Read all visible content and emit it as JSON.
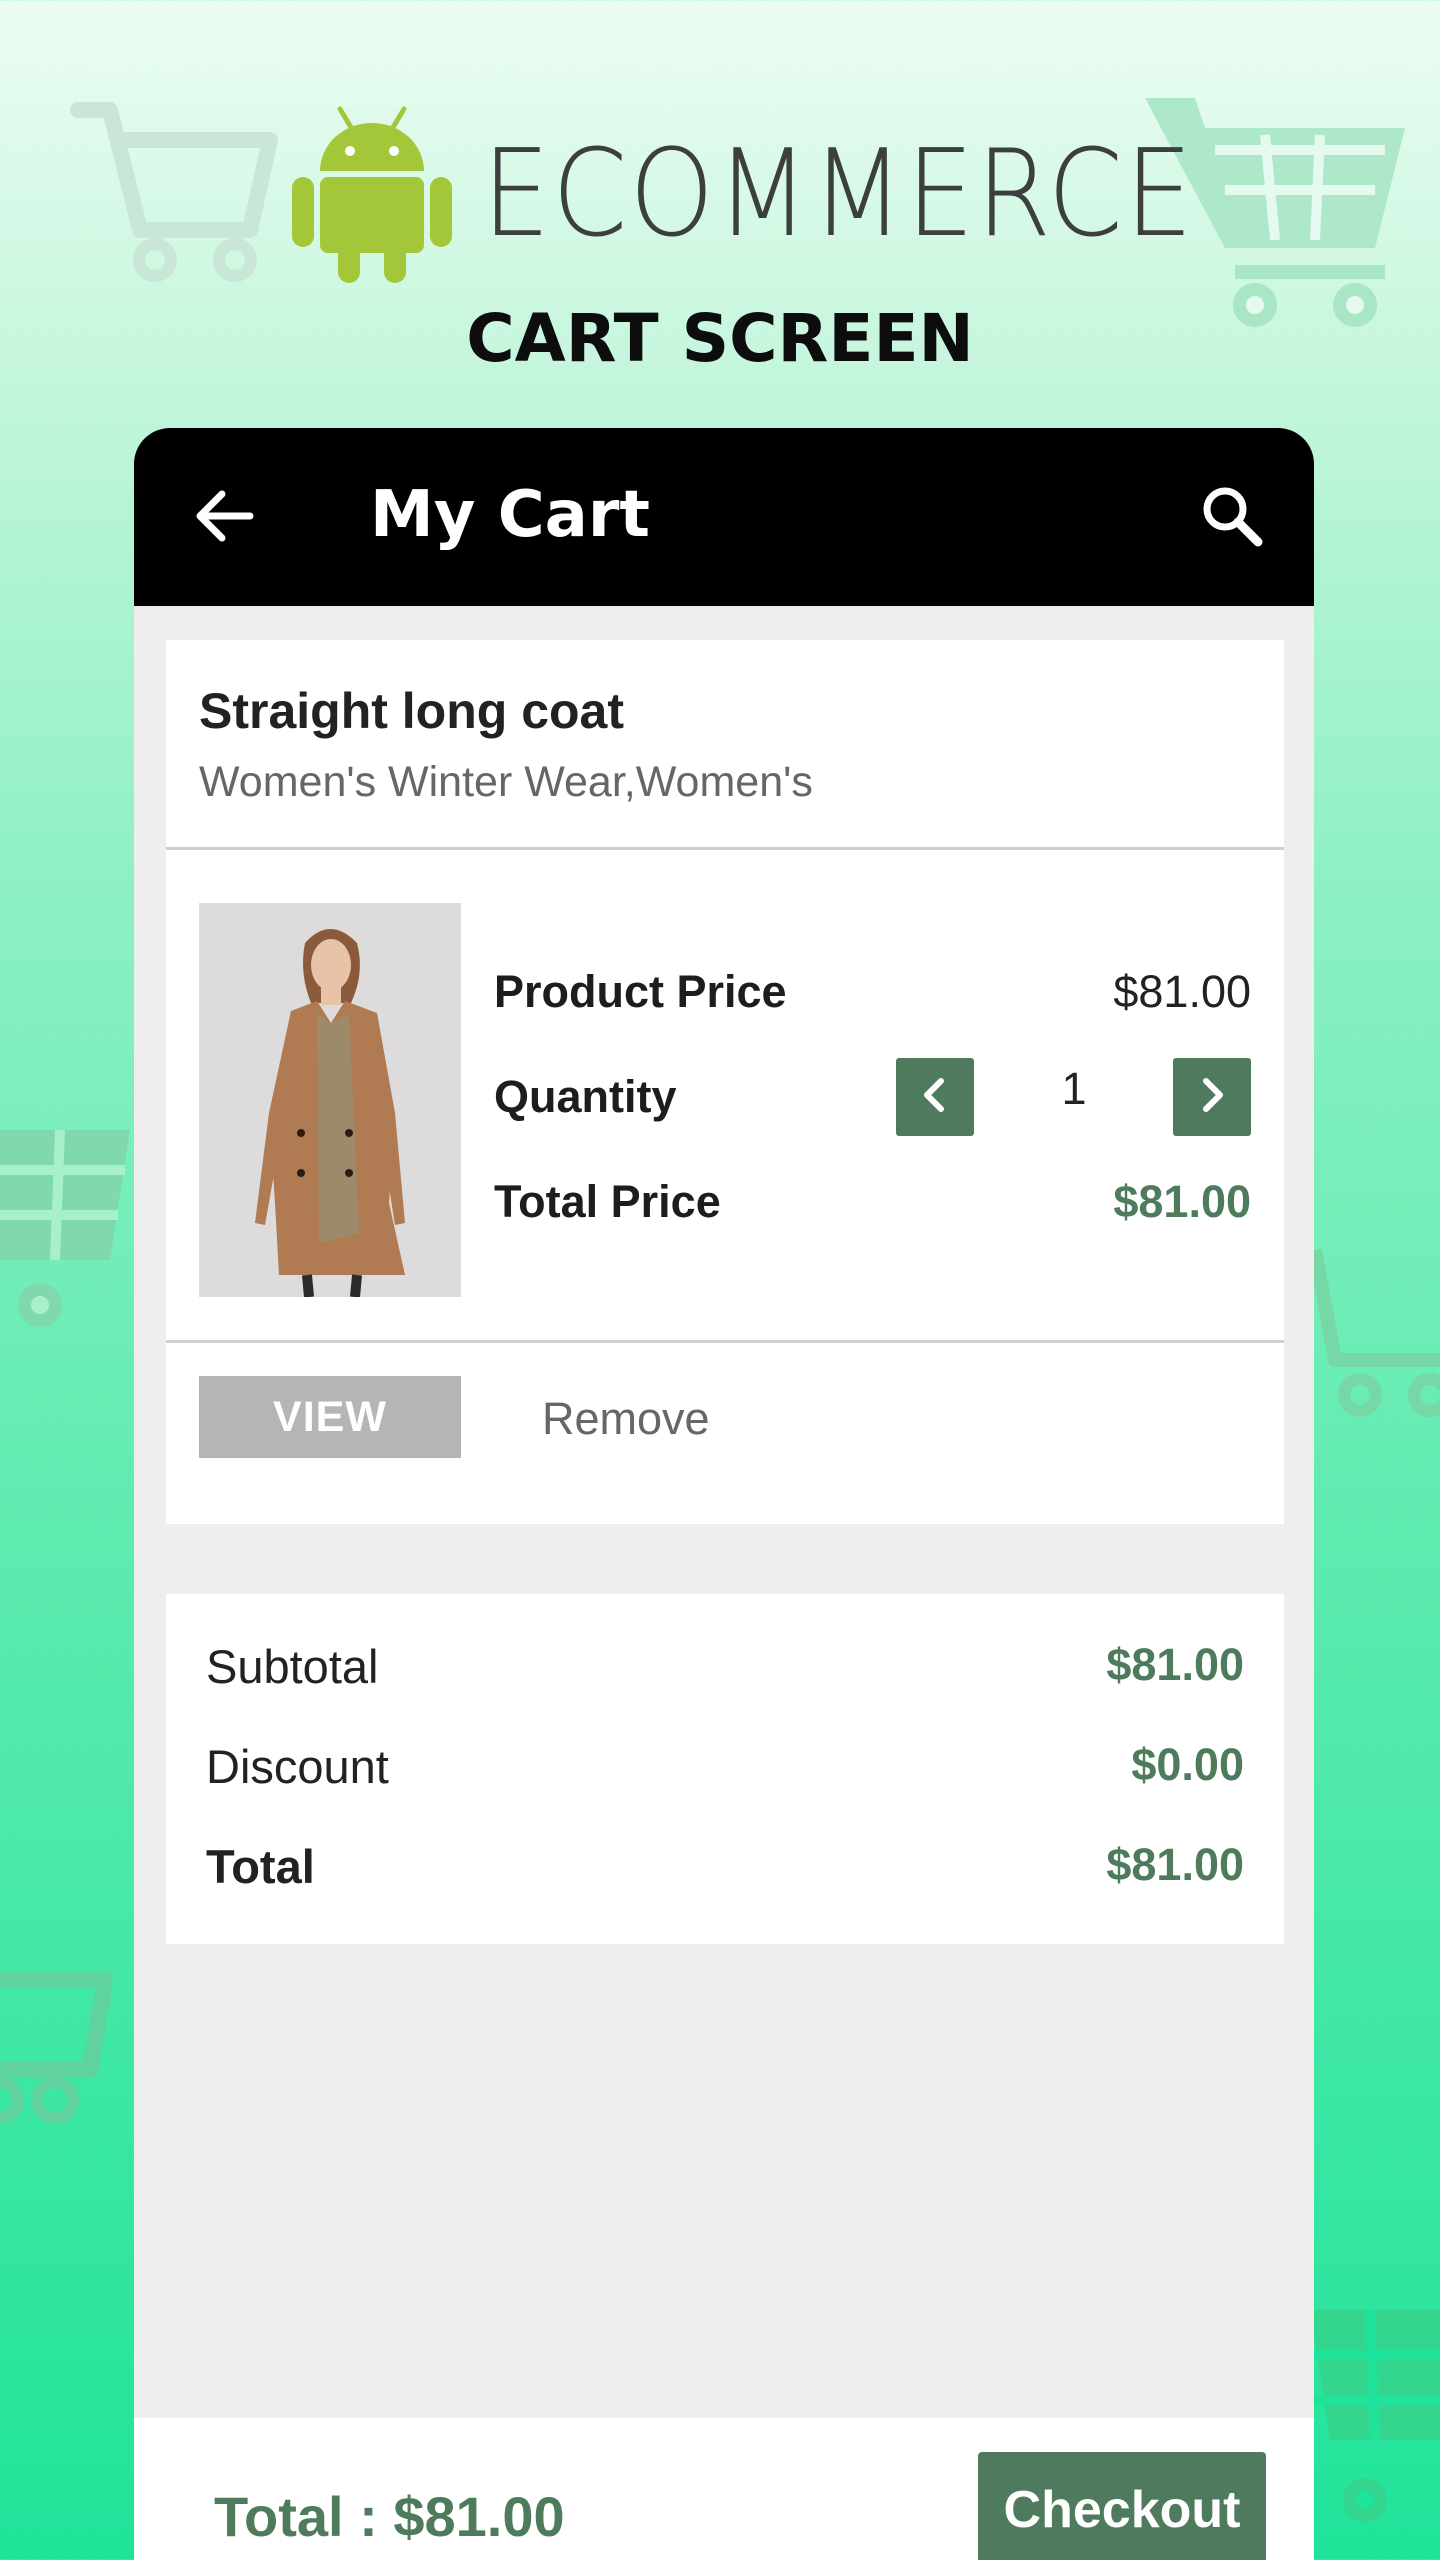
{
  "brand": {
    "wordmark": "ECOMMERCE",
    "screen_title": "CART SCREEN",
    "logo_icon": "android-icon",
    "colors": {
      "android_green": "#a4c639",
      "cart_watermark": "#7fd9ad"
    }
  },
  "appbar": {
    "title": "My Cart",
    "back_icon": "arrow-left-icon",
    "search_icon": "search-icon"
  },
  "cart_item": {
    "name": "Straight long coat",
    "category": "Women's Winter Wear,Women's",
    "image_description": "woman-in-camel-coat",
    "product_price_label": "Product Price",
    "product_price": "$81.00",
    "quantity_label": "Quantity",
    "quantity": "1",
    "total_price_label": "Total Price",
    "total_price": "$81.00",
    "view_label": "VIEW",
    "remove_label": "Remove"
  },
  "summary": {
    "subtotal_label": "Subtotal",
    "subtotal": "$81.00",
    "discount_label": "Discount",
    "discount": "$0.00",
    "total_label": "Total",
    "total": "$81.00"
  },
  "bottom_bar": {
    "total_text": "Total : $81.00",
    "checkout_label": "Checkout"
  },
  "colors": {
    "accent_green": "#4e7a5d",
    "appbar": "#000000",
    "view_button": "#b5b5b5"
  }
}
